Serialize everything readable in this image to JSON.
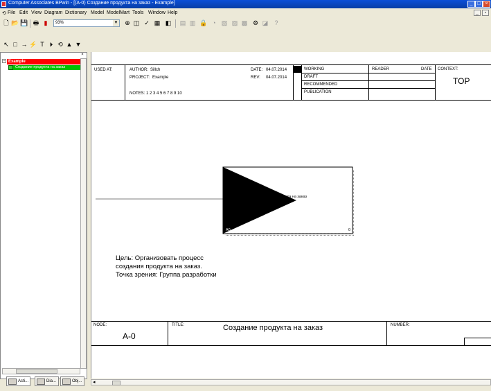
{
  "window": {
    "title": "Computer Associates BPwin - [(A-0) Создание продукта на заказ - Example]"
  },
  "menu": [
    "File",
    "Edit",
    "View",
    "Diagram",
    "Dictionary",
    "Model",
    "ModelMart",
    "Tools",
    "Window",
    "Help"
  ],
  "toolbar": {
    "zoom": "93%"
  },
  "tree": {
    "root": "Example",
    "child": "Создание продукта на заказ"
  },
  "panel_tabs": [
    "Acti...",
    "Dia...",
    "Obj..."
  ],
  "header": {
    "used_at": "USED AT:",
    "author_label": "AUTHOR:",
    "author": "Sillch",
    "project_label": "PROJECT:",
    "project": "Example",
    "notes_label": "NOTES:",
    "notes": "1 2 3 4 5 6 7 8 9 10",
    "date_label": "DATE:",
    "date": "04.07.2014",
    "rev_label": "REV:",
    "rev": "04.07.2014",
    "status": [
      "WORKING",
      "DRAFT",
      "RECOMMENDED",
      "PUBLICATION"
    ],
    "reader": "READER",
    "date2": "DATE",
    "context_label": "CONTEXT:",
    "context": "TOP"
  },
  "activity": {
    "name": "Создание продукта на заказ",
    "number": "A0",
    "cost": "0"
  },
  "goal": {
    "line1": "Цель:  Организовать процесс",
    "line2": "создания продукта на заказ.",
    "line3": "Точка зрения: Группа разработки"
  },
  "footer": {
    "node_label": "NODE:",
    "node": "A-0",
    "title_label": "TITLE:",
    "title": "Создание продукта на заказ",
    "number_label": "NUMBER:"
  },
  "colors": {
    "root": "#ff0000",
    "child": "#00c000",
    "titlebar": "#0b4fd8"
  }
}
